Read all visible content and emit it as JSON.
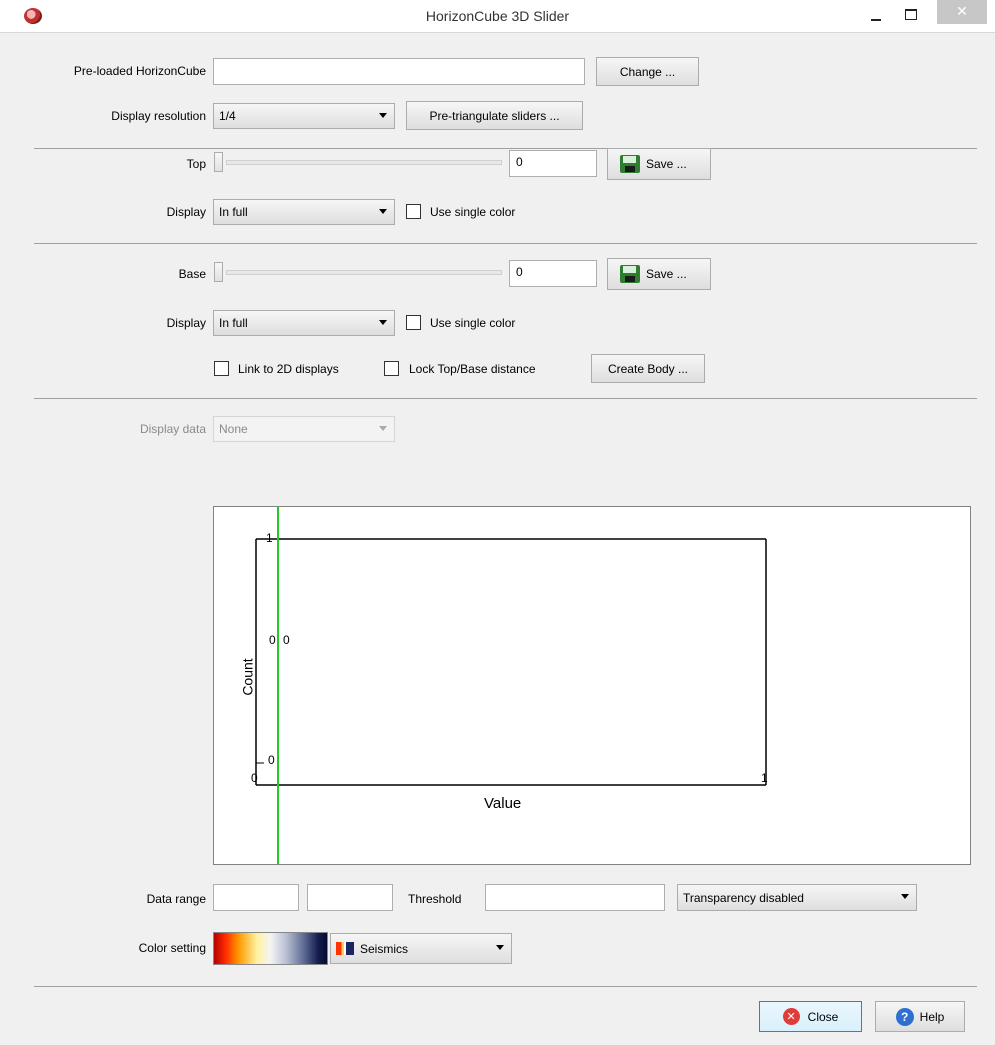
{
  "window": {
    "title": "HorizonCube 3D Slider",
    "close_glyph": "✕"
  },
  "horizoncube": {
    "label": "Pre-loaded HorizonCube",
    "value": "",
    "change_button": "Change ..."
  },
  "resolution": {
    "label": "Display resolution",
    "value": "1/4",
    "pretriangulate_button": "Pre-triangulate sliders ..."
  },
  "top": {
    "label": "Top",
    "slider_position": 0,
    "value": "0",
    "save_button": "Save ...",
    "display_label": "Display",
    "display_value": "In full",
    "single_color_label": "Use single color"
  },
  "base": {
    "label": "Base",
    "slider_position": 0,
    "value": "0",
    "save_button": "Save ...",
    "display_label": "Display",
    "display_value": "In full",
    "single_color_label": "Use single color"
  },
  "options": {
    "link_2d": "Link to 2D displays",
    "lock_distance": "Lock Top/Base distance",
    "create_body_button": "Create Body ..."
  },
  "display_data": {
    "label": "Display data",
    "value": "None"
  },
  "chart_data": {
    "type": "line",
    "xlabel": "Value",
    "ylabel": "Count",
    "xlim": [
      0,
      1
    ],
    "ylim": [
      0,
      1
    ],
    "x_tick_labels": [
      "0",
      "1"
    ],
    "y_tick_labels": [
      "0",
      "1"
    ],
    "marker_labels": [
      "0",
      "0"
    ],
    "marker_line": {
      "x": 0,
      "color": "#22cc22"
    },
    "series": [
      {
        "x": [
          0,
          1
        ],
        "y": [
          1,
          1
        ]
      }
    ]
  },
  "data_range": {
    "label": "Data range",
    "min": "",
    "max": ""
  },
  "threshold": {
    "label": "Threshold",
    "value": ""
  },
  "transparency": {
    "value": "Transparency disabled"
  },
  "color": {
    "label": "Color setting",
    "colortable": "Seismics"
  },
  "footer": {
    "close_button": "Close",
    "help_button": "Help",
    "help_glyph": "?",
    "close_glyph": "✕"
  },
  "icons": {
    "app": "app-logo-icon",
    "save": "floppy-disk-icon",
    "close": "close-circle-icon",
    "help": "help-circle-icon"
  }
}
